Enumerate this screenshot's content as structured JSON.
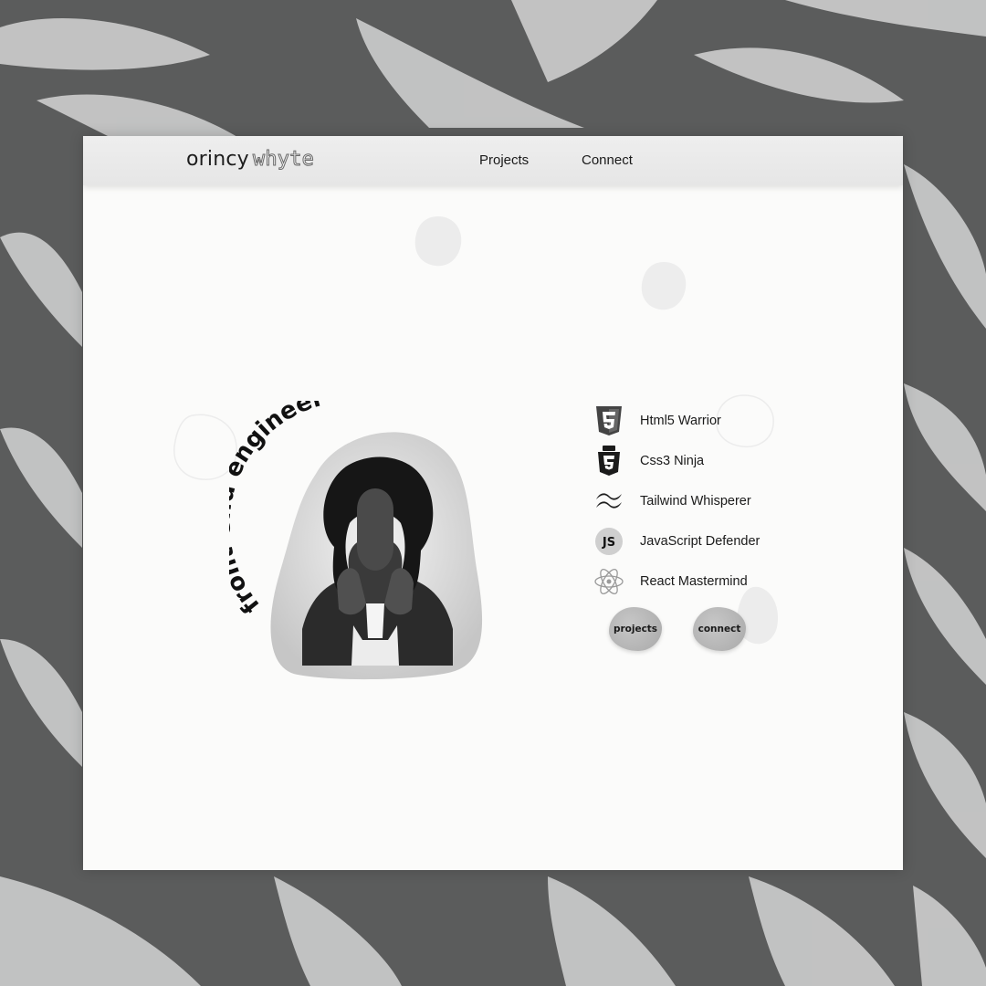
{
  "brand": {
    "first_name": "orincy",
    "last_name": "whyte"
  },
  "nav": {
    "projects_label": "Projects",
    "connect_label": "Connect"
  },
  "hero": {
    "arc_text": "front-end engineer"
  },
  "skills": [
    {
      "icon": "html5-icon",
      "label": "Html5 Warrior"
    },
    {
      "icon": "css3-icon",
      "label": "Css3 Ninja"
    },
    {
      "icon": "tailwind-icon",
      "label": "Tailwind Whisperer"
    },
    {
      "icon": "javascript-icon",
      "label": "JavaScript Defender"
    },
    {
      "icon": "react-icon",
      "label": "React Mastermind"
    }
  ],
  "cta": {
    "projects_label": "projects",
    "connect_label": "connect"
  },
  "colors": {
    "background": "#5b5c5c",
    "card": "#fbfbfa",
    "navbar": "#ececec",
    "button": "#b8b8b8",
    "text": "#1a1a1a"
  }
}
